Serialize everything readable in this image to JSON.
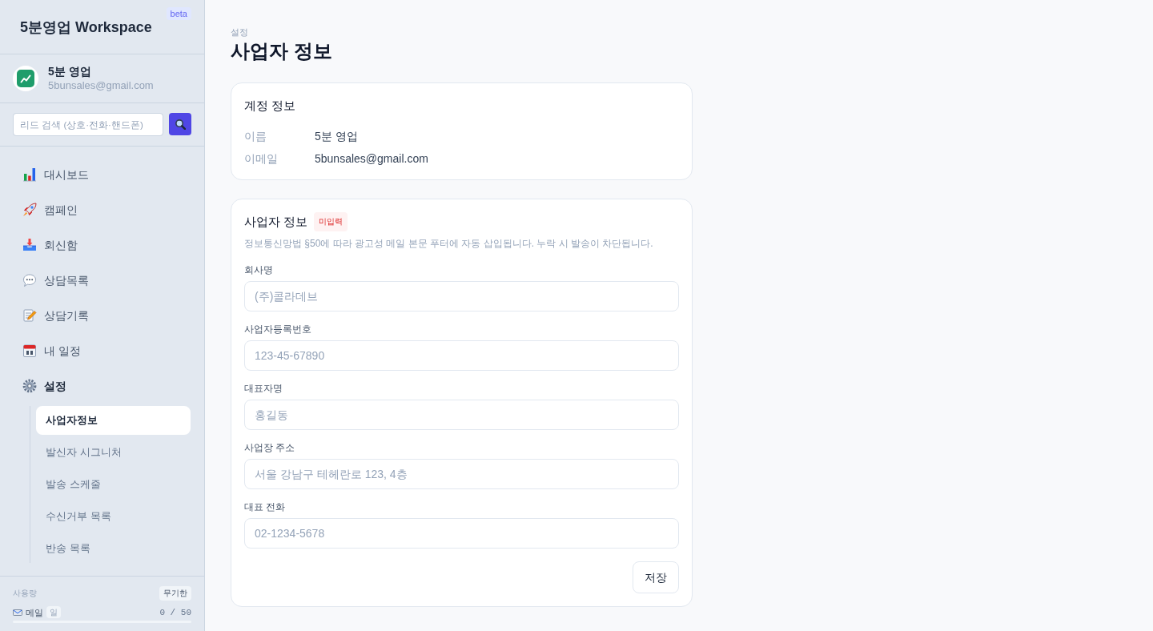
{
  "sidebar": {
    "brand": {
      "title": "5분영업 Workspace",
      "badge": "beta"
    },
    "profile": {
      "name": "5분 영업",
      "email": "5bunsales@gmail.com"
    },
    "search": {
      "placeholder": "리드 검색 (상호·전화·핸드폰)"
    },
    "nav": [
      {
        "label": "대시보드",
        "selected": false
      },
      {
        "label": "캠페인",
        "selected": false
      },
      {
        "label": "회신함",
        "selected": false
      },
      {
        "label": "상담목록",
        "selected": false
      },
      {
        "label": "상담기록",
        "selected": false
      },
      {
        "label": "내 일정",
        "selected": false
      },
      {
        "label": "설정",
        "selected": true,
        "children": [
          {
            "label": "사업자정보",
            "selected": true
          },
          {
            "label": "발신자 시그니처",
            "selected": false
          },
          {
            "label": "발송 스케줄",
            "selected": false
          },
          {
            "label": "수신거부 목록",
            "selected": false
          },
          {
            "label": "반송 목록",
            "selected": false
          }
        ]
      }
    ],
    "usage": {
      "label": "사용량",
      "badge": "무기한",
      "meters": [
        {
          "label": "메일",
          "unit": "일",
          "reading": "0 / 50",
          "level": 0
        }
      ]
    }
  },
  "main": {
    "breadcrumb": "설정",
    "title": "사업자 정보",
    "account_card": {
      "title": "계정 정보",
      "rows": [
        {
          "label": "이름",
          "value": "5분 영업"
        },
        {
          "label": "이메일",
          "value": "5bunsales@gmail.com"
        }
      ]
    },
    "business_card": {
      "title": "사업자 정보",
      "badge": "미입력",
      "description": "정보통신망법 §50에 따라 광고성 메일 본문 푸터에 자동 삽입됩니다. 누락 시 발송이 차단됩니다.",
      "fields": [
        {
          "label": "회사명",
          "placeholder": "(주)콜라데브"
        },
        {
          "label": "사업자등록번호",
          "placeholder": "123-45-67890"
        },
        {
          "label": "대표자명",
          "placeholder": "홍길동"
        },
        {
          "label": "사업장 주소",
          "placeholder": "서울 강남구 테헤란로 123, 4층"
        },
        {
          "label": "대표 전화",
          "placeholder": "02-1234-5678"
        }
      ],
      "save_button": "저장"
    }
  }
}
